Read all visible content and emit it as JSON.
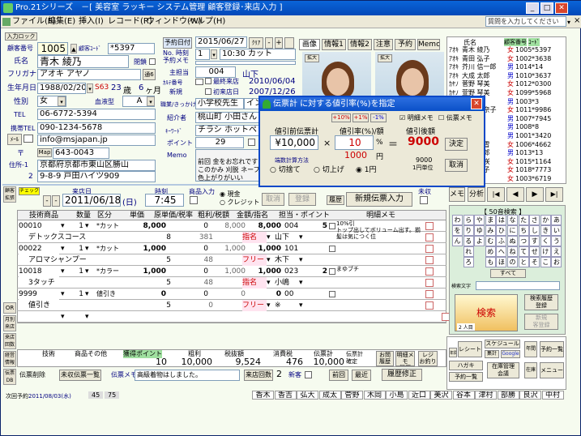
{
  "window": {
    "title": "Pro.21シリーズ　－[ 美容室 ラッキー システム管理 顧客登録･来店入力 ]"
  },
  "menubar": [
    "ファイル(F)",
    "編集(E)",
    "挿入(I)",
    "レコード(R)",
    "ウィンドウ(W)",
    "ヘルプ(H)"
  ],
  "help_search": {
    "placeholder": "質問を入力してください"
  },
  "customer": {
    "input_lock": "入力ロック",
    "number_label": "顧客番号",
    "number": "1005",
    "code_label": "顧客ｺｰﾄﾞ",
    "code": "*5397",
    "name_label": "氏名",
    "name": "青木 綾乃",
    "closed_label": "閉鎖",
    "kana_label": "フリガナ",
    "kana": "アオキ アヤノ",
    "level": "通6",
    "birth_label": "生年月日",
    "birth": "1988/02/20",
    "era": "S63",
    "age": "23",
    "age_unit": "歳",
    "months": "6",
    "months_unit": "ヶ月",
    "sex_label": "性別",
    "sex": "女",
    "blood_label": "血液型",
    "blood": "A",
    "tel_label": "TEL",
    "tel": "06-6772-5394",
    "mobile_label": "携帯TEL",
    "mobile": "090-1234-5678",
    "mail_label": "ﾒｰﾙ",
    "mail": "info@msjapan.jp",
    "post_btn": "〒",
    "map_btn": "Map",
    "zip": "643-0043",
    "addr_label": "住所-1",
    "addr1": "京都府京都市東山区勝山",
    "addr2_label": "2",
    "addr2": "9-8-9 戸田ハイツ909"
  },
  "reservation": {
    "label": "予約日付",
    "date": "2015/06/27",
    "clear": "ｸﾘｱ",
    "minus": "-",
    "plus": "+",
    "no_label": "No. 時刻",
    "no": "1",
    "time": "10:30 カット",
    "menu_label": "予約メモ"
  },
  "details": {
    "staff_label": "主担当",
    "staff_code": "004",
    "staff_name": "山下",
    "cur_date_label": "ｶﾙﾃ番号",
    "last_visit_label": "最終来店",
    "last_visit": "2010/06/04",
    "new_label": "新規",
    "first_visit_label": "初来店日",
    "first_visit": "2007/12/26",
    "job_label": "職業/きっかけ",
    "job": "小学校先生",
    "intro": "インター",
    "referrer_label": "紹介者",
    "referrer": "桃山町 小田さん",
    "keyword_label": "ｷｰﾜｰﾄﾞ",
    "keyword": "チラシ ホットペッパー",
    "point_label": "ポイント",
    "point": "29",
    "memo_label": "Memo",
    "memo": "前回 金をお忘れです\nこのかみ 刈脱 ネープ\n色上がりがいい"
  },
  "tabs": [
    "画像",
    "情報1",
    "情報2",
    "注意",
    "予約",
    "Memo"
  ],
  "photos": {
    "caption1": "拡大",
    "caption2": "拡大"
  },
  "visit": {
    "checkout": "チェックアウト",
    "date_label": "来店日",
    "date": "2011/06/18",
    "weekday": "(日)",
    "time_label": "時刻",
    "time": "7:45",
    "product_label": "商品入力",
    "pay_cash": "現金",
    "pay_credit": "クレジット",
    "cancel": "取消",
    "register": "登録",
    "history": "履歴",
    "new_slip": "新規伝票入力",
    "uncollected": "未収"
  },
  "grid": {
    "headers": [
      "技術商品",
      "数量",
      "区分",
      "単価",
      "原単価/税率",
      "粗利/税額",
      "金額/指名",
      "担当・ポイント",
      "明細メモ"
    ],
    "rows": [
      {
        "code": "00010",
        "qty": "1",
        "kind": "*カット",
        "price": "8,000",
        "cost": "0",
        "gross": "8,000",
        "amount": "8,000",
        "staff": "004",
        "pt": "5",
        "name": "デトックスコース",
        "tax": "8",
        "taxamt": "381",
        "nom": "指名",
        "stf": "山下",
        "memo": "10%引\nトップ出してボリューム出す。揃\n髪は気につく位"
      },
      {
        "code": "00022",
        "qty": "1",
        "kind": "*カット",
        "price": "1,000",
        "cost": "0",
        "gross": "1,000",
        "amount": "1,000",
        "staff": "101",
        "pt": "",
        "name": "アロマシャンプー",
        "tax": "5",
        "taxamt": "48",
        "nom": "フリー",
        "stf": "木下",
        "memo": ""
      },
      {
        "code": "10018",
        "qty": "1",
        "kind": "*カラー",
        "price": "1,000",
        "cost": "0",
        "gross": "1,000",
        "amount": "1,000",
        "staff": "023",
        "pt": "2",
        "name": "3タッチ",
        "tax": "5",
        "taxamt": "48",
        "nom": "指名",
        "stf": "小嶋",
        "memo": "まゆブチ"
      },
      {
        "code": "9999",
        "qty": "1",
        "kind": "値引き",
        "price": "0",
        "cost": "0",
        "gross": "0",
        "amount": "0",
        "staff": "00",
        "pt": "",
        "name": "値引き",
        "tax": "5",
        "taxamt": "0",
        "nom": "フリー",
        "stf": "※",
        "memo": ""
      }
    ]
  },
  "totals": {
    "tech_label": "技術",
    "goods_label": "商品その他",
    "point_label": "獲得ポイント",
    "gross_label": "粗利",
    "tax_label": "税抜額",
    "consumption_label": "消費税",
    "slip_label": "伝票計",
    "point": "10",
    "gross": "10,000",
    "tax_ex": "9,524",
    "consumption": "476",
    "slip_total": "10,000",
    "settle": "伝票計\n確定",
    "history_btn": "お問\n履歴",
    "memo_history": "明細メモ\n履歴",
    "receipt": "レジ\nお釣り"
  },
  "slip_bar": {
    "delete": "伝票削除",
    "uncollected_list": "未収伝票一覧",
    "memo_label": "伝票メモ",
    "memo": "高級着物はしました。",
    "count_label": "来店回数",
    "count": "2",
    "new_label": "新客",
    "prev": "前回",
    "latest": "最近",
    "history_fix": "履歴修正"
  },
  "footer": {
    "next_label": "次回予約",
    "next": "2011/08/03(水)",
    "point_a": "45",
    "point_b": "75"
  },
  "side_labels": [
    "顧客\n拡張",
    "OR",
    "月別\n来店",
    "来店\n回数",
    "経営\n情報",
    "伝票\nDB"
  ],
  "dialog": {
    "title": "伝票計 に対する値引率(%)を指定",
    "before_label": "値引前伝票計",
    "rate_label": "値引率(%)/額",
    "after_label": "値引後額",
    "before": "¥10,000",
    "times": "×",
    "rate": "10",
    "percent": "%",
    "equals": "＝",
    "after": "9000",
    "amount": "1000",
    "yen": "円",
    "note_a": "9000",
    "note_b": "1円単位",
    "btn_10": "+10%",
    "btn_1": "+1%",
    "btn_m1": "-1%",
    "memo_detail": "明細メモ",
    "memo_slip": "伝票メモ",
    "method_label": "端数計算方法",
    "opt1": "切捨て",
    "opt2": "切上げ",
    "opt3": "1円",
    "ok": "決定",
    "cancel": "取消"
  },
  "customer_list": {
    "header_name": "氏名",
    "header_no": "顧客番号",
    "header_code": "ｺｰﾄﾞ",
    "rows": [
      {
        "kana": "ｱｵｷ",
        "name": "青木 綾乃",
        "sex": "女",
        "no": "1005",
        "code": "*5397"
      },
      {
        "kana": "ｱｵｷ",
        "name": "青田 弘子",
        "sex": "女",
        "no": "1002",
        "code": "*3638"
      },
      {
        "kana": "ｱｵｷ",
        "name": "芥川 信一郎",
        "sex": "男",
        "no": "1014",
        "code": "*14"
      },
      {
        "kana": "ｱｵｷ",
        "name": "大成 太郎",
        "sex": "男",
        "no": "1010",
        "code": "*3637"
      },
      {
        "kana": "ｶﾔﾉ",
        "name": "菅野 琴美",
        "sex": "女",
        "no": "1012",
        "code": "*0300"
      },
      {
        "kana": "ｶﾔﾉ",
        "name": "萱野 琴美",
        "sex": "女",
        "no": "1099",
        "code": "*5968"
      },
      {
        "kana": "ｷﾄﾞ",
        "name": "北野 一",
        "sex": "男",
        "no": "1003",
        "code": "*3"
      },
      {
        "kana": "ｷﾄﾞ",
        "name": "吉田 美奈子",
        "sex": "女",
        "no": "1011",
        "code": "*9986"
      },
      {
        "kana": "ｺﾝﾄﾞ",
        "name": "近藤 宏",
        "sex": "男",
        "no": "1007",
        "code": "*7945"
      },
      {
        "kana": "ｻｴｷ",
        "name": "佐伯 清",
        "sex": "男",
        "no": "1008",
        "code": "*8"
      },
      {
        "kana": "ｻｲﾄ",
        "name": "斉藤 一",
        "sex": "男",
        "no": "1001",
        "code": "*3420"
      },
      {
        "kana": "ｼﾞﾝﾉ",
        "name": "神野 美雪",
        "sex": "女",
        "no": "1006",
        "code": "*4662"
      },
      {
        "kana": "ｽｽﾞｷ",
        "name": "鈴木 一郎",
        "sex": "男",
        "no": "1013",
        "code": "*13"
      },
      {
        "kana": "ﾀｶﾊ",
        "name": "高橋 美咲",
        "sex": "女",
        "no": "1015",
        "code": "*1164"
      },
      {
        "kana": "ﾀﾅｶ",
        "name": "田中 優子",
        "sex": "女",
        "no": "1018",
        "code": "*7773"
      },
      {
        "kana": "ﾂﾀﾞ",
        "name": "津田 恵",
        "sex": "女",
        "no": "1003",
        "code": "*6719"
      }
    ]
  },
  "nav": {
    "memo": "メモ",
    "analysis": "分析",
    "first": "|◀",
    "prev": "◀",
    "next": "▶",
    "last": "▶|"
  },
  "kana_panel": {
    "title": "【 50音検索 】",
    "chars": [
      "わ",
      "ら",
      "や",
      "ま",
      "は",
      "な",
      "た",
      "さ",
      "か",
      "あ",
      "を",
      "り",
      "ゆ",
      "み",
      "ひ",
      "に",
      "ち",
      "し",
      "き",
      "い",
      "ん",
      "る",
      "よ",
      "む",
      "ふ",
      "ぬ",
      "つ",
      "す",
      "く",
      "う",
      "",
      "れ",
      "",
      "め",
      "へ",
      "ね",
      "て",
      "せ",
      "け",
      "え",
      "",
      "ろ",
      "",
      "も",
      "ほ",
      "の",
      "と",
      "そ",
      "こ",
      "お"
    ],
    "all": "すべて",
    "input_label": "検索文字",
    "search": "検索",
    "count": "2 人目",
    "history_search": "検索履歴\n登録",
    "new_register": "新規\n客登録"
  },
  "tools": {
    "receipt": "レシート",
    "schedule": "スケジュール",
    "calendar": "予約一覧",
    "postcard": "ハガキ",
    "total": "在庫管理\n会議",
    "stock": "在庫",
    "menu": "メニュー",
    "ranking": "集計",
    "google": "Google",
    "year": "年間"
  },
  "bottom_names": [
    "香木",
    "香吉田",
    "弘大",
    "成太郎",
    "菅野琴美",
    "木岡沢子",
    "小島鳴子",
    "近口",
    "美沢",
    "谷本太",
    "津村",
    "部勝田",
    "良沢",
    "中村静"
  ]
}
